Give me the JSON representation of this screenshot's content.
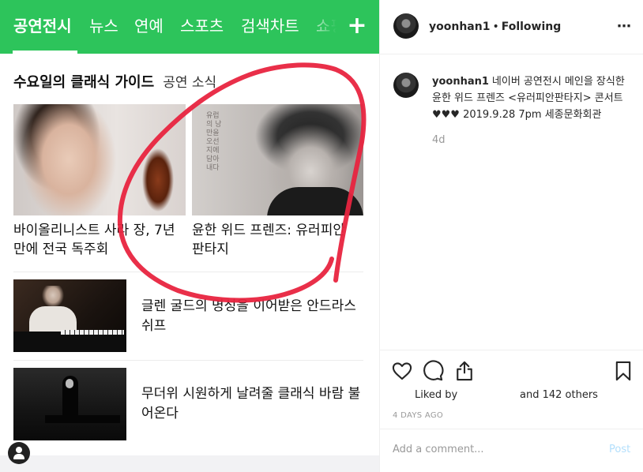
{
  "naver": {
    "tabs": [
      {
        "label": "공연전시"
      },
      {
        "label": "뉴스"
      },
      {
        "label": "연예"
      },
      {
        "label": "스포츠"
      },
      {
        "label": "검색차트"
      },
      {
        "label": "쇼핑"
      }
    ],
    "plus_icon": "+",
    "section": {
      "title": "수요일의 클래식 가이드",
      "subtitle": "공연 소식"
    },
    "cards": [
      {
        "caption": "바이올리니스트 사라 장, 7년 만에 전국 독주회"
      },
      {
        "caption": "윤한 위드 프렌즈: 유러피안 판타지",
        "poster_text": "유럽의 낭만을 오선지에 담아내다"
      }
    ],
    "rows": [
      {
        "title": "글렌 굴드의 명성을 이어받은 안드라스 쉬프"
      },
      {
        "title": "무더위 시원하게 날려줄 클래식 바람 불어온다"
      }
    ]
  },
  "instagram": {
    "username": "yoonhan1",
    "separator": "•",
    "follow_status": "Following",
    "more_icon": "⋯",
    "caption": {
      "username": "yoonhan1",
      "text": "네이버 공연전시 메인을 장식한 윤한 위드 프렌즈 <유러피안판타지> 콘서트 ♥♥♥ 2019.9.28 7pm 세종문화회관",
      "time": "4d"
    },
    "liked_by_label": "Liked by",
    "others_label": "and 142 others",
    "posted_ago": "4 DAYS AGO",
    "comment_placeholder": "Add a comment...",
    "post_label": "Post"
  },
  "colors": {
    "naver_green": "#2dc45b",
    "annotation_red": "#e8243f",
    "post_disabled": "#b2dffc"
  }
}
